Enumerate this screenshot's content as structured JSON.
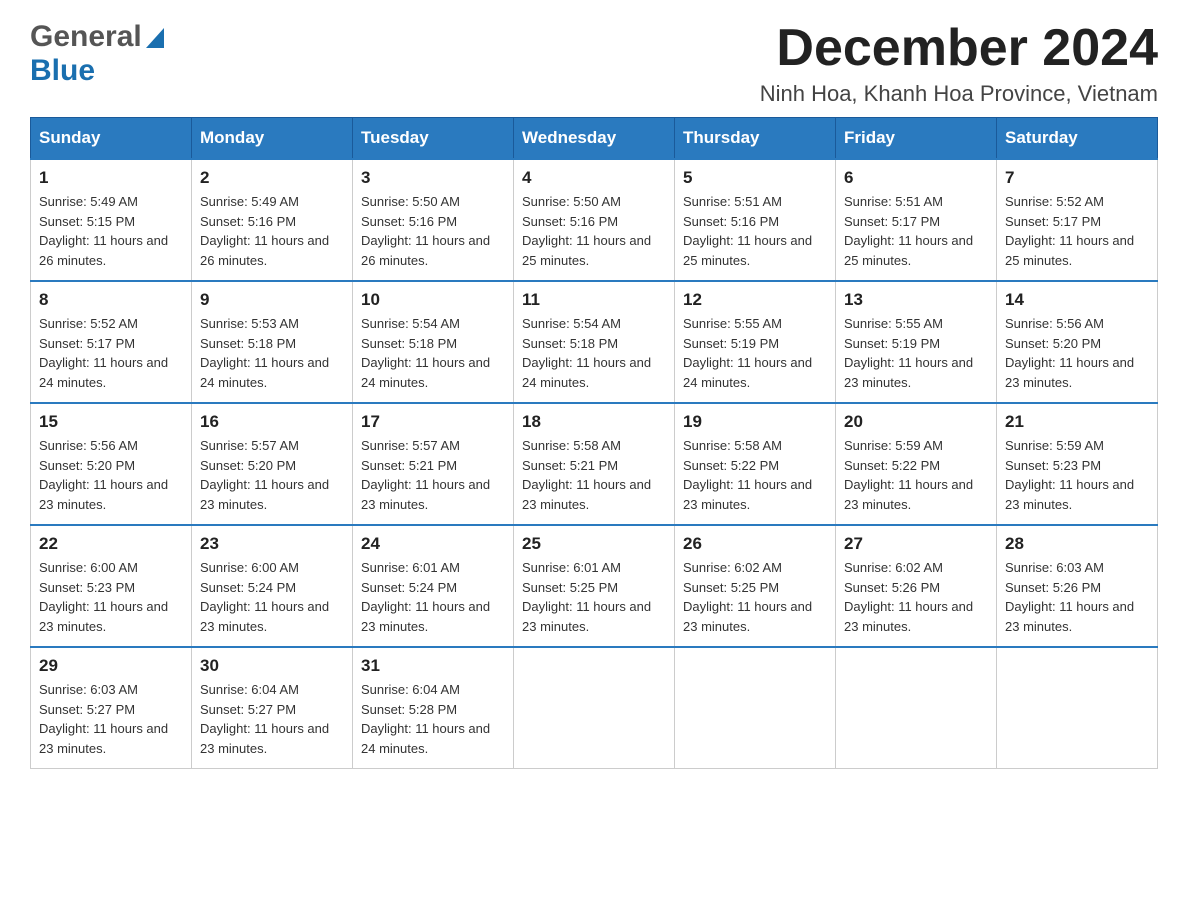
{
  "header": {
    "logo_general": "General",
    "logo_blue": "Blue",
    "month_title": "December 2024",
    "location": "Ninh Hoa, Khanh Hoa Province, Vietnam"
  },
  "days_of_week": [
    "Sunday",
    "Monday",
    "Tuesday",
    "Wednesday",
    "Thursday",
    "Friday",
    "Saturday"
  ],
  "weeks": [
    [
      {
        "day": "1",
        "sunrise": "Sunrise: 5:49 AM",
        "sunset": "Sunset: 5:15 PM",
        "daylight": "Daylight: 11 hours and 26 minutes."
      },
      {
        "day": "2",
        "sunrise": "Sunrise: 5:49 AM",
        "sunset": "Sunset: 5:16 PM",
        "daylight": "Daylight: 11 hours and 26 minutes."
      },
      {
        "day": "3",
        "sunrise": "Sunrise: 5:50 AM",
        "sunset": "Sunset: 5:16 PM",
        "daylight": "Daylight: 11 hours and 26 minutes."
      },
      {
        "day": "4",
        "sunrise": "Sunrise: 5:50 AM",
        "sunset": "Sunset: 5:16 PM",
        "daylight": "Daylight: 11 hours and 25 minutes."
      },
      {
        "day": "5",
        "sunrise": "Sunrise: 5:51 AM",
        "sunset": "Sunset: 5:16 PM",
        "daylight": "Daylight: 11 hours and 25 minutes."
      },
      {
        "day": "6",
        "sunrise": "Sunrise: 5:51 AM",
        "sunset": "Sunset: 5:17 PM",
        "daylight": "Daylight: 11 hours and 25 minutes."
      },
      {
        "day": "7",
        "sunrise": "Sunrise: 5:52 AM",
        "sunset": "Sunset: 5:17 PM",
        "daylight": "Daylight: 11 hours and 25 minutes."
      }
    ],
    [
      {
        "day": "8",
        "sunrise": "Sunrise: 5:52 AM",
        "sunset": "Sunset: 5:17 PM",
        "daylight": "Daylight: 11 hours and 24 minutes."
      },
      {
        "day": "9",
        "sunrise": "Sunrise: 5:53 AM",
        "sunset": "Sunset: 5:18 PM",
        "daylight": "Daylight: 11 hours and 24 minutes."
      },
      {
        "day": "10",
        "sunrise": "Sunrise: 5:54 AM",
        "sunset": "Sunset: 5:18 PM",
        "daylight": "Daylight: 11 hours and 24 minutes."
      },
      {
        "day": "11",
        "sunrise": "Sunrise: 5:54 AM",
        "sunset": "Sunset: 5:18 PM",
        "daylight": "Daylight: 11 hours and 24 minutes."
      },
      {
        "day": "12",
        "sunrise": "Sunrise: 5:55 AM",
        "sunset": "Sunset: 5:19 PM",
        "daylight": "Daylight: 11 hours and 24 minutes."
      },
      {
        "day": "13",
        "sunrise": "Sunrise: 5:55 AM",
        "sunset": "Sunset: 5:19 PM",
        "daylight": "Daylight: 11 hours and 23 minutes."
      },
      {
        "day": "14",
        "sunrise": "Sunrise: 5:56 AM",
        "sunset": "Sunset: 5:20 PM",
        "daylight": "Daylight: 11 hours and 23 minutes."
      }
    ],
    [
      {
        "day": "15",
        "sunrise": "Sunrise: 5:56 AM",
        "sunset": "Sunset: 5:20 PM",
        "daylight": "Daylight: 11 hours and 23 minutes."
      },
      {
        "day": "16",
        "sunrise": "Sunrise: 5:57 AM",
        "sunset": "Sunset: 5:20 PM",
        "daylight": "Daylight: 11 hours and 23 minutes."
      },
      {
        "day": "17",
        "sunrise": "Sunrise: 5:57 AM",
        "sunset": "Sunset: 5:21 PM",
        "daylight": "Daylight: 11 hours and 23 minutes."
      },
      {
        "day": "18",
        "sunrise": "Sunrise: 5:58 AM",
        "sunset": "Sunset: 5:21 PM",
        "daylight": "Daylight: 11 hours and 23 minutes."
      },
      {
        "day": "19",
        "sunrise": "Sunrise: 5:58 AM",
        "sunset": "Sunset: 5:22 PM",
        "daylight": "Daylight: 11 hours and 23 minutes."
      },
      {
        "day": "20",
        "sunrise": "Sunrise: 5:59 AM",
        "sunset": "Sunset: 5:22 PM",
        "daylight": "Daylight: 11 hours and 23 minutes."
      },
      {
        "day": "21",
        "sunrise": "Sunrise: 5:59 AM",
        "sunset": "Sunset: 5:23 PM",
        "daylight": "Daylight: 11 hours and 23 minutes."
      }
    ],
    [
      {
        "day": "22",
        "sunrise": "Sunrise: 6:00 AM",
        "sunset": "Sunset: 5:23 PM",
        "daylight": "Daylight: 11 hours and 23 minutes."
      },
      {
        "day": "23",
        "sunrise": "Sunrise: 6:00 AM",
        "sunset": "Sunset: 5:24 PM",
        "daylight": "Daylight: 11 hours and 23 minutes."
      },
      {
        "day": "24",
        "sunrise": "Sunrise: 6:01 AM",
        "sunset": "Sunset: 5:24 PM",
        "daylight": "Daylight: 11 hours and 23 minutes."
      },
      {
        "day": "25",
        "sunrise": "Sunrise: 6:01 AM",
        "sunset": "Sunset: 5:25 PM",
        "daylight": "Daylight: 11 hours and 23 minutes."
      },
      {
        "day": "26",
        "sunrise": "Sunrise: 6:02 AM",
        "sunset": "Sunset: 5:25 PM",
        "daylight": "Daylight: 11 hours and 23 minutes."
      },
      {
        "day": "27",
        "sunrise": "Sunrise: 6:02 AM",
        "sunset": "Sunset: 5:26 PM",
        "daylight": "Daylight: 11 hours and 23 minutes."
      },
      {
        "day": "28",
        "sunrise": "Sunrise: 6:03 AM",
        "sunset": "Sunset: 5:26 PM",
        "daylight": "Daylight: 11 hours and 23 minutes."
      }
    ],
    [
      {
        "day": "29",
        "sunrise": "Sunrise: 6:03 AM",
        "sunset": "Sunset: 5:27 PM",
        "daylight": "Daylight: 11 hours and 23 minutes."
      },
      {
        "day": "30",
        "sunrise": "Sunrise: 6:04 AM",
        "sunset": "Sunset: 5:27 PM",
        "daylight": "Daylight: 11 hours and 23 minutes."
      },
      {
        "day": "31",
        "sunrise": "Sunrise: 6:04 AM",
        "sunset": "Sunset: 5:28 PM",
        "daylight": "Daylight: 11 hours and 24 minutes."
      },
      {
        "day": "",
        "sunrise": "",
        "sunset": "",
        "daylight": ""
      },
      {
        "day": "",
        "sunrise": "",
        "sunset": "",
        "daylight": ""
      },
      {
        "day": "",
        "sunrise": "",
        "sunset": "",
        "daylight": ""
      },
      {
        "day": "",
        "sunrise": "",
        "sunset": "",
        "daylight": ""
      }
    ]
  ]
}
